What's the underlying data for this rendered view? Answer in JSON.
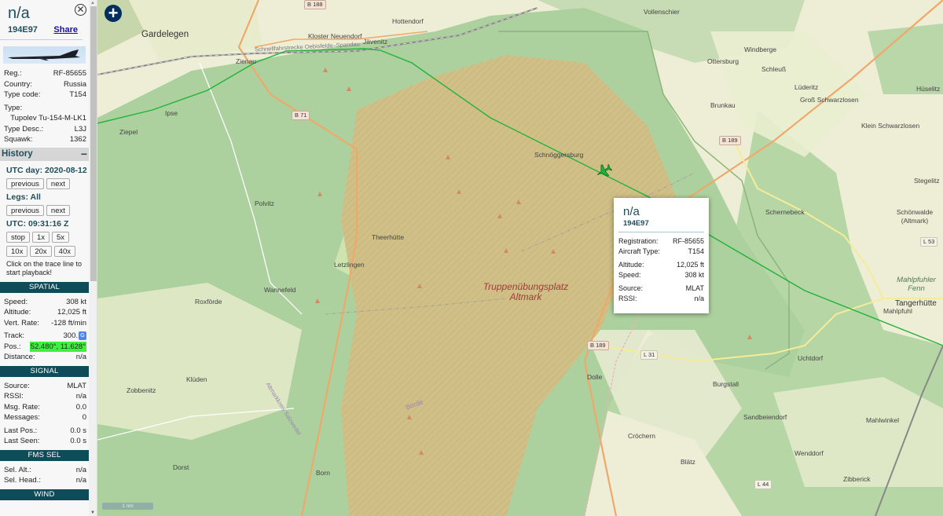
{
  "aircraft": {
    "name": "n/a",
    "hex": "194E97",
    "share_label": "Share",
    "close_icon": "close-circle-icon",
    "photo_alt": "aircraft-photo"
  },
  "details": [
    {
      "label": "Reg.:",
      "value": "RF-85655"
    },
    {
      "label": "Country:",
      "value": "Russia"
    },
    {
      "label": "Type code:",
      "value": "T154"
    }
  ],
  "type": {
    "label": "Type:",
    "value": "Tupolev Tu-154-M-LK1"
  },
  "details2": [
    {
      "label": "Type Desc.:",
      "value": "L3J"
    },
    {
      "label": "Squawk:",
      "value": "1362"
    }
  ],
  "history": {
    "title": "History",
    "collapse_symbol": "−",
    "utc_day": "UTC day: 2020-08-12",
    "prev_label": "previous",
    "next_label": "next",
    "legs": "Legs: All",
    "utc_time": "UTC: 09:31:16 Z",
    "speeds": [
      "stop",
      "1x",
      "5x",
      "10x",
      "20x",
      "40x"
    ],
    "hint": "Click on the trace line to start playback!"
  },
  "spatial": {
    "title": "SPATIAL",
    "speed": {
      "label": "Speed:",
      "value": "308 kt"
    },
    "altitude": {
      "label": "Altitude:",
      "value": "12,025 ft"
    },
    "vert_rate": {
      "label": "Vert. Rate:",
      "value": "-128 ft/min"
    },
    "track": {
      "label": "Track:",
      "value": "300."
    },
    "pos": {
      "label": "Pos.:",
      "value": "52.480°, 11.628°"
    },
    "distance": {
      "label": "Distance:",
      "value": "n/a"
    },
    "translate_icon": "G"
  },
  "signal": {
    "title": "SIGNAL",
    "source": {
      "label": "Source:",
      "value": "MLAT"
    },
    "rssi": {
      "label": "RSSI:",
      "value": "n/a"
    },
    "msg_rate": {
      "label": "Msg. Rate:",
      "value": "0.0"
    },
    "messages": {
      "label": "Messages:",
      "value": "0"
    },
    "last_pos": {
      "label": "Last Pos.:",
      "value": "0.0 s"
    },
    "last_seen": {
      "label": "Last Seen:",
      "value": "0.0 s"
    }
  },
  "fms": {
    "title": "FMS SEL",
    "sel_alt": {
      "label": "Sel. Alt.:",
      "value": "n/a"
    },
    "sel_head": {
      "label": "Sel. Head.:",
      "value": "n/a"
    }
  },
  "wind": {
    "title": "WIND"
  },
  "tooltip": {
    "name": "n/a",
    "hex": "194E97",
    "registration": {
      "label": "Registration:",
      "value": "RF-85655"
    },
    "aircraft_type": {
      "label": "Aircraft Type:",
      "value": "T154"
    },
    "altitude": {
      "label": "Altitude:",
      "value": "12,025 ft"
    },
    "speed": {
      "label": "Speed:",
      "value": "308 kt"
    },
    "source": {
      "label": "Source:",
      "value": "MLAT"
    },
    "rssi": {
      "label": "RSSI:",
      "value": "n/a"
    }
  },
  "map": {
    "zoom_in_symbol": "+",
    "scale_label": "1 nm",
    "trace_color": "#1fb33a",
    "aircraft_color": "#1fb33a",
    "places": {
      "gardelegen": "Gardelegen",
      "kloster": "Kloster Neuendorf",
      "javenitz": "Jävenitz",
      "hottendorf": "Hottendorf",
      "vollenschier": "Vollenschier",
      "windberge": "Windberge",
      "ottersburg": "Ottersburg",
      "schleuss": "Schleuß",
      "luderitz": "Lüderitz",
      "huselitz": "Hüselitz",
      "gross": "Groß Schwarzlosen",
      "brunkau": "Brunkau",
      "klein": "Klein Schwarzlosen",
      "ipse": "Ipse",
      "ziepel": "Ziepel",
      "zienau": "Zienau",
      "schnoggersburg": "Schnöggersburg",
      "stegelitz": "Stegelitz",
      "schernebeck": "Schernebeck",
      "schonwalde": "Schönwalde (Altmark)",
      "polvitz": "Polvitz",
      "theerhutte": "Theerhütte",
      "letzlingen": "Letzlingen",
      "wannefeld": "Wannefeld",
      "roxforde": "Roxförde",
      "truppen": "Truppenübungsplatz Altmark",
      "mahlpfuhler": "Mahlpfuhler Fenn",
      "mahlpfuhl": "Mahlpfuhl",
      "tangerhutte": "Tangerhütte",
      "uchtdorf": "Uchtdorf",
      "dolle": "Dolle",
      "burgstall": "Burgstall",
      "sandbeiendorf": "Sandbeiendorf",
      "mahlwinkel": "Mahlwinkel",
      "zobbenitz": "Zobbenitz",
      "kluden": "Klüden",
      "crochern": "Cröchern",
      "blatz": "Blätz",
      "wenddorf": "Wenddorf",
      "zibberick": "Zibberick",
      "dorst": "Dorst",
      "born": "Born",
      "borde": "Börde",
      "altmarkkreis": "Altmarkkreis Salzwedel",
      "schnellfahr": "Schnellfahrstrecke Oebisfelde–Spandau"
    },
    "roads": {
      "b188": "B 188",
      "b71": "B 71",
      "b189_n": "B 189",
      "b189_s": "B 189",
      "l53": "L 53",
      "l31": "L 31",
      "l44": "L 44"
    }
  }
}
